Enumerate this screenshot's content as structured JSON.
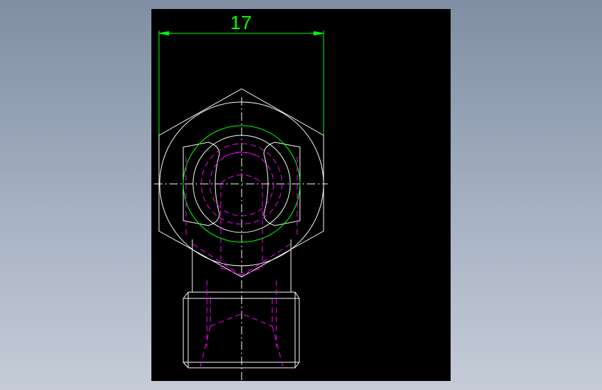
{
  "drawing": {
    "dimension_label": "17",
    "colors": {
      "background": "#000000",
      "outline": "#ffffff",
      "dimension": "#00ff00",
      "hidden": "#ff00ff",
      "centerline": "#ffffff"
    }
  }
}
